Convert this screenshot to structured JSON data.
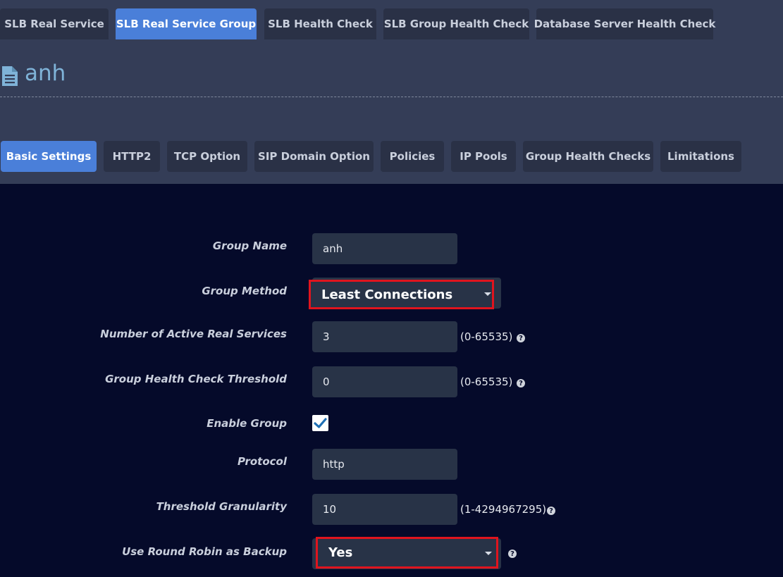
{
  "top_tabs": [
    {
      "label": "SLB Real Service",
      "active": false
    },
    {
      "label": "SLB Real Service Group",
      "active": true
    },
    {
      "label": "SLB Health Check",
      "active": false
    },
    {
      "label": "SLB Group Health Check",
      "active": false
    },
    {
      "label": "Database Server Health Check",
      "active": false
    }
  ],
  "page": {
    "title": "anh",
    "icon": "document-icon"
  },
  "sub_tabs": [
    {
      "label": "Basic Settings",
      "active": true
    },
    {
      "label": "HTTP2",
      "active": false
    },
    {
      "label": "TCP Option",
      "active": false
    },
    {
      "label": "SIP Domain Option",
      "active": false
    },
    {
      "label": "Policies",
      "active": false
    },
    {
      "label": "IP Pools",
      "active": false
    },
    {
      "label": "Group Health Checks",
      "active": false
    },
    {
      "label": "Limitations",
      "active": false
    }
  ],
  "form": {
    "group_name": {
      "label": "Group Name",
      "value": "anh"
    },
    "group_method": {
      "label": "Group Method",
      "value": "Least Connections"
    },
    "active_real_services": {
      "label": "Number of Active Real Services",
      "value": "3",
      "range": "(0-65535)"
    },
    "health_check_threshold": {
      "label": "Group Health Check Threshold",
      "value": "0",
      "range": "(0-65535)"
    },
    "enable_group": {
      "label": "Enable Group",
      "checked": true
    },
    "protocol": {
      "label": "Protocol",
      "value": "http"
    },
    "threshold_granularity": {
      "label": "Threshold Granularity",
      "value": "10",
      "range": "(1-4294967295)"
    },
    "round_robin_backup": {
      "label": "Use Round Robin as Backup",
      "value": "Yes"
    }
  },
  "colors": {
    "accent": "#4a7fd9",
    "highlight_border": "#e0141e",
    "panel_bg": "#050a2a",
    "page_bg": "#343d57"
  }
}
